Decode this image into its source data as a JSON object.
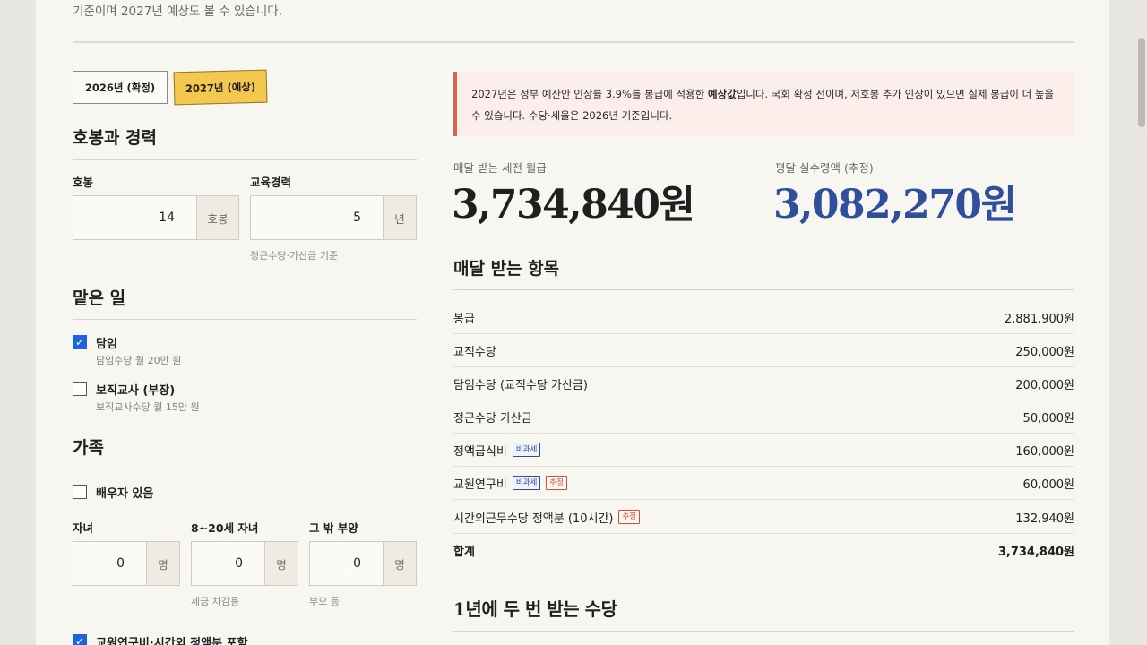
{
  "intro_text": "기준이며 2027년 예상도 볼 수 있습니다.",
  "tabs": [
    {
      "label": "2026년 (확정)",
      "active": false
    },
    {
      "label": "2027년 (예상)",
      "active": true
    }
  ],
  "career": {
    "title": "호봉과 경력",
    "step": {
      "label": "호봉",
      "value": "14",
      "unit": "호봉"
    },
    "edu": {
      "label": "교육경력",
      "value": "5",
      "unit": "년",
      "hint": "정근수당·가산금 기준"
    }
  },
  "duties": {
    "title": "맡은 일",
    "homeroom": {
      "label": "담임",
      "sub": "담임수당 월 20만 원",
      "checked": true
    },
    "head": {
      "label": "보직교사 (부장)",
      "sub": "보직교사수당 월 15만 원",
      "checked": false
    }
  },
  "family": {
    "title": "가족",
    "spouse": {
      "label": "배우자 있음",
      "checked": false
    },
    "children": {
      "label": "자녀",
      "value": "0",
      "unit": "명"
    },
    "teens": {
      "label": "8~20세 자녀",
      "value": "0",
      "unit": "명",
      "hint": "세금 차감용"
    },
    "others": {
      "label": "그 밖 부양",
      "value": "0",
      "unit": "명",
      "hint": "부모 등"
    }
  },
  "include_extra": {
    "label": "교원연구비·시간외 정액분 포함",
    "checked": true
  },
  "notice": {
    "pre": "2027년은 정부 예산안 인상률 3.9%를 봉급에 적용한 ",
    "bold": "예상값",
    "post": "입니다. 국회 확정 전이며, 저호봉 추가 인상이 있으면 실제 봉급이 더 높을 수 있습니다. 수당·세율은 2026년 기준입니다."
  },
  "kpi": {
    "gross_label": "매달 받는 세전 월급",
    "gross_value": "3,734,840원",
    "net_label": "평달 실수령액 (추정)",
    "net_value": "3,082,270원"
  },
  "monthly": {
    "title": "매달 받는 항목",
    "tax_free_badge": "비과세",
    "estimate_badge": "추정",
    "rows": [
      {
        "name": "봉급",
        "amount": "2,881,900원"
      },
      {
        "name": "교직수당",
        "amount": "250,000원"
      },
      {
        "name": "담임수당 (교직수당 가산금)",
        "amount": "200,000원"
      },
      {
        "name": "정근수당 가산금",
        "amount": "50,000원"
      },
      {
        "name": "정액급식비",
        "amount": "160,000원"
      },
      {
        "name": "교원연구비",
        "amount": "60,000원"
      },
      {
        "name": "시간외근무수당 정액분 (10시간)",
        "amount": "132,940원"
      }
    ],
    "total": {
      "name": "합계",
      "amount": "3,734,840원"
    }
  },
  "twice_title": "1년에 두 번 받는 수당",
  "colors": {
    "accent_yellow": "#f3c84e",
    "accent_blue": "#2f4f9a",
    "accent_red": "#d9624a",
    "check_blue": "#1f63d8"
  }
}
